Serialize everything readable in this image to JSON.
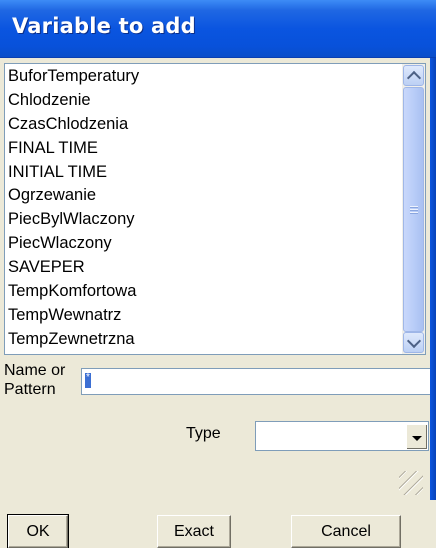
{
  "window": {
    "title": "Variable to add"
  },
  "variables": [
    "BuforTemperatury",
    "Chlodzenie",
    "CzasChlodzenia",
    "FINAL TIME",
    "INITIAL TIME",
    "Ogrzewanie",
    "PiecBylWlaczony",
    "PiecWlaczony",
    "SAVEPER",
    "TempKomfortowa",
    "TempWewnatrz",
    "TempZewnetrzna"
  ],
  "form": {
    "name_label": "Name or Pattern",
    "name_value": "*",
    "type_label": "Type",
    "type_value": ""
  },
  "buttons": {
    "ok": "OK",
    "exact": "Exact",
    "cancel": "Cancel"
  },
  "icons": {
    "scroll_up": "chevron-up-icon",
    "scroll_down": "chevron-down-icon",
    "dropdown": "caret-down-icon",
    "resize": "resize-grip-icon"
  }
}
